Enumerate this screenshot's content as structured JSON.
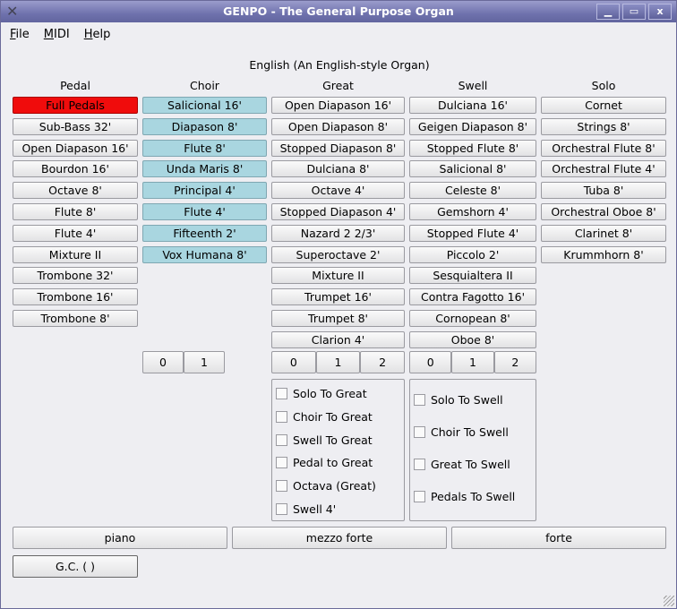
{
  "window": {
    "title": "GENPO - The General Purpose Organ",
    "buttons": [
      "▁",
      "▭",
      "x"
    ]
  },
  "menu": [
    {
      "label": "File",
      "u": "F",
      "rest": "ile"
    },
    {
      "label": "MIDI",
      "u": "M",
      "rest": "IDI"
    },
    {
      "label": "Help",
      "u": "H",
      "rest": "elp"
    }
  ],
  "organ_name": "English (An English-style Organ)",
  "divisions": [
    {
      "name": "Pedal",
      "stops": [
        "Full Pedals",
        "Sub-Bass 32'",
        "Open Diapason 16'",
        "Bourdon 16'",
        "Octave 8'",
        "Flute 8'",
        "Flute 4'",
        "Mixture II",
        "Trombone 32'",
        "Trombone 16'",
        "Trombone 8'"
      ],
      "active": [
        0
      ],
      "active_color": "#f00c0c",
      "registrations": []
    },
    {
      "name": "Choir",
      "stops": [
        "Salicional 16'",
        "Diapason 8'",
        "Flute 8'",
        "Unda Maris 8'",
        "Principal 4'",
        "Flute 4'",
        "Fifteenth 2'",
        "Vox Humana 8'"
      ],
      "active": [
        0,
        1,
        2,
        3,
        4,
        5,
        6,
        7
      ],
      "active_color": "#a9d6e0",
      "registrations": [
        "0",
        "1"
      ]
    },
    {
      "name": "Great",
      "stops": [
        "Open Diapason 16'",
        "Open Diapason 8'",
        "Stopped Diapason 8'",
        "Dulciana 8'",
        "Octave 4'",
        "Stopped Diapason 4'",
        "Nazard 2 2/3'",
        "Superoctave 2'",
        "Mixture II",
        "Trumpet 16'",
        "Trumpet 8'",
        "Clarion 4'"
      ],
      "active": [],
      "registrations": [
        "0",
        "1",
        "2"
      ]
    },
    {
      "name": "Swell",
      "stops": [
        "Dulciana 16'",
        "Geigen Diapason 8'",
        "Stopped Flute 8'",
        "Salicional 8'",
        "Celeste 8'",
        "Gemshorn 4'",
        "Stopped Flute 4'",
        "Piccolo 2'",
        "Sesquialtera II",
        "Contra Fagotto 16'",
        "Cornopean 8'",
        "Oboe 8'"
      ],
      "active": [],
      "registrations": [
        "0",
        "1",
        "2"
      ]
    },
    {
      "name": "Solo",
      "stops": [
        "Cornet",
        "Strings 8'",
        "Orchestral Flute 8'",
        "Orchestral Flute 4'",
        "Tuba 8'",
        "Orchestral Oboe 8'",
        "Clarinet 8'",
        "Krummhorn 8'"
      ],
      "active": [],
      "registrations": []
    }
  ],
  "great_couplers": [
    {
      "label": "Solo To Great",
      "checked": false
    },
    {
      "label": "Choir To Great",
      "checked": false
    },
    {
      "label": "Swell To Great",
      "checked": false
    },
    {
      "label": "Pedal to Great",
      "checked": false
    },
    {
      "label": "Octava (Great)",
      "checked": false
    },
    {
      "label": "Swell 4'",
      "checked": false
    }
  ],
  "swell_couplers": [
    {
      "label": "Solo To Swell",
      "checked": false
    },
    {
      "label": "Choir To Swell",
      "checked": false
    },
    {
      "label": "Great To Swell",
      "checked": false
    },
    {
      "label": "Pedals To Swell",
      "checked": false
    }
  ],
  "presets": [
    "piano",
    "mezzo forte",
    "forte"
  ],
  "general_cancel": "G.C. ( )"
}
